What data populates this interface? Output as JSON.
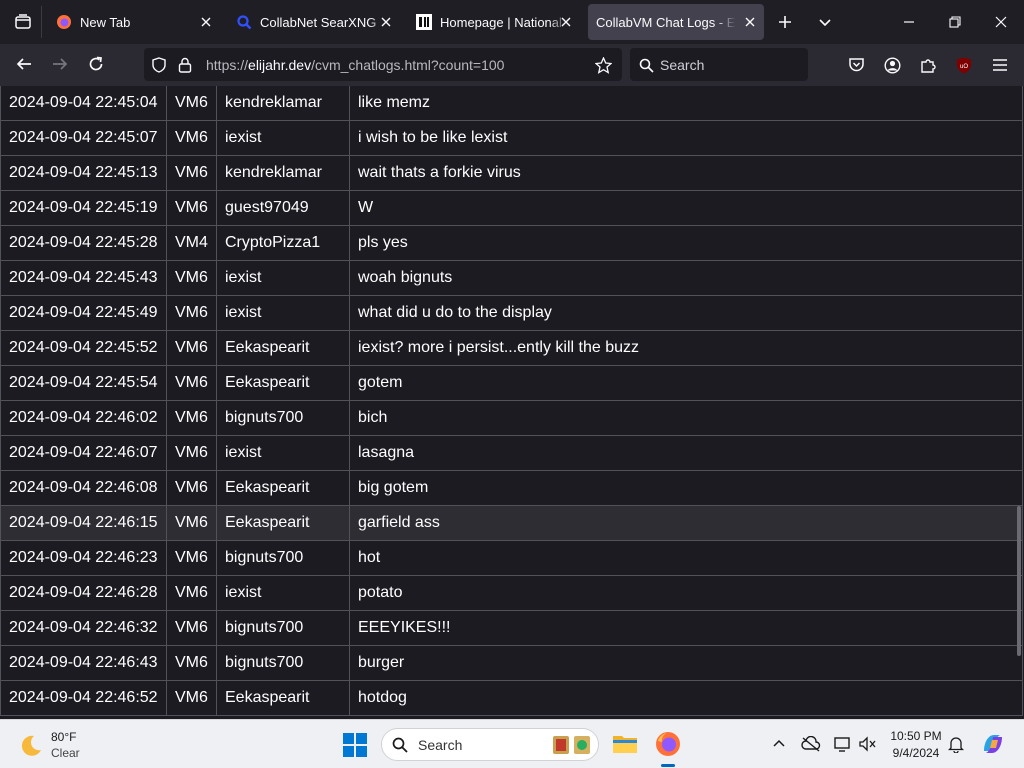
{
  "browser": {
    "tabs": [
      {
        "label": "New Tab",
        "favicon": "firefox-icon",
        "active": false
      },
      {
        "label": "CollabNet SearXNG",
        "favicon": "searxng-magnifier-icon",
        "active": false
      },
      {
        "label": "Homepage | National S",
        "favicon": "911-memorial-icon",
        "active": false
      },
      {
        "label": "CollabVM Chat Logs - Elija",
        "favicon": "none",
        "active": true
      }
    ],
    "url_prefix": "https://",
    "url_domain": "elijahr.dev",
    "url_path": "/cvm_chatlogs.html?count=100",
    "search_placeholder": "Search"
  },
  "chatlog": {
    "rows": [
      {
        "time": "2024-09-04 22:45:04",
        "vm": "VM6",
        "user": "kendreklamar",
        "msg": "like memz"
      },
      {
        "time": "2024-09-04 22:45:07",
        "vm": "VM6",
        "user": "iexist",
        "msg": "i wish to be like lexist"
      },
      {
        "time": "2024-09-04 22:45:13",
        "vm": "VM6",
        "user": "kendreklamar",
        "msg": "wait thats a forkie virus"
      },
      {
        "time": "2024-09-04 22:45:19",
        "vm": "VM6",
        "user": "guest97049",
        "msg": "W"
      },
      {
        "time": "2024-09-04 22:45:28",
        "vm": "VM4",
        "user": "CryptoPizza1",
        "msg": "pls yes"
      },
      {
        "time": "2024-09-04 22:45:43",
        "vm": "VM6",
        "user": "iexist",
        "msg": "woah bignuts"
      },
      {
        "time": "2024-09-04 22:45:49",
        "vm": "VM6",
        "user": "iexist",
        "msg": "what did u do to the display"
      },
      {
        "time": "2024-09-04 22:45:52",
        "vm": "VM6",
        "user": "Eekaspearit",
        "msg": "iexist? more i persist...ently kill the buzz"
      },
      {
        "time": "2024-09-04 22:45:54",
        "vm": "VM6",
        "user": "Eekaspearit",
        "msg": "gotem"
      },
      {
        "time": "2024-09-04 22:46:02",
        "vm": "VM6",
        "user": "bignuts700",
        "msg": "bich"
      },
      {
        "time": "2024-09-04 22:46:07",
        "vm": "VM6",
        "user": "iexist",
        "msg": "lasagna"
      },
      {
        "time": "2024-09-04 22:46:08",
        "vm": "VM6",
        "user": "Eekaspearit",
        "msg": "big gotem"
      },
      {
        "time": "2024-09-04 22:46:15",
        "vm": "VM6",
        "user": "Eekaspearit",
        "msg": "garfield ass"
      },
      {
        "time": "2024-09-04 22:46:23",
        "vm": "VM6",
        "user": "bignuts700",
        "msg": "hot"
      },
      {
        "time": "2024-09-04 22:46:28",
        "vm": "VM6",
        "user": "iexist",
        "msg": "potato"
      },
      {
        "time": "2024-09-04 22:46:32",
        "vm": "VM6",
        "user": "bignuts700",
        "msg": "EEEYIKES!!!"
      },
      {
        "time": "2024-09-04 22:46:43",
        "vm": "VM6",
        "user": "bignuts700",
        "msg": "burger"
      },
      {
        "time": "2024-09-04 22:46:52",
        "vm": "VM6",
        "user": "Eekaspearit",
        "msg": "hotdog"
      }
    ],
    "hovered_row": 12
  },
  "taskbar": {
    "weather_temp": "80°F",
    "weather_condition": "Clear",
    "search_placeholder": "Search",
    "clock_time": "10:50 PM",
    "clock_date": "9/4/2024"
  },
  "colors": {
    "page_bg": "#1c1b22",
    "tab_active_bg": "#42414d",
    "table_border": "#52525a",
    "taskbar_bg": "#eef0f3",
    "windows_blue": "#0067c0"
  }
}
